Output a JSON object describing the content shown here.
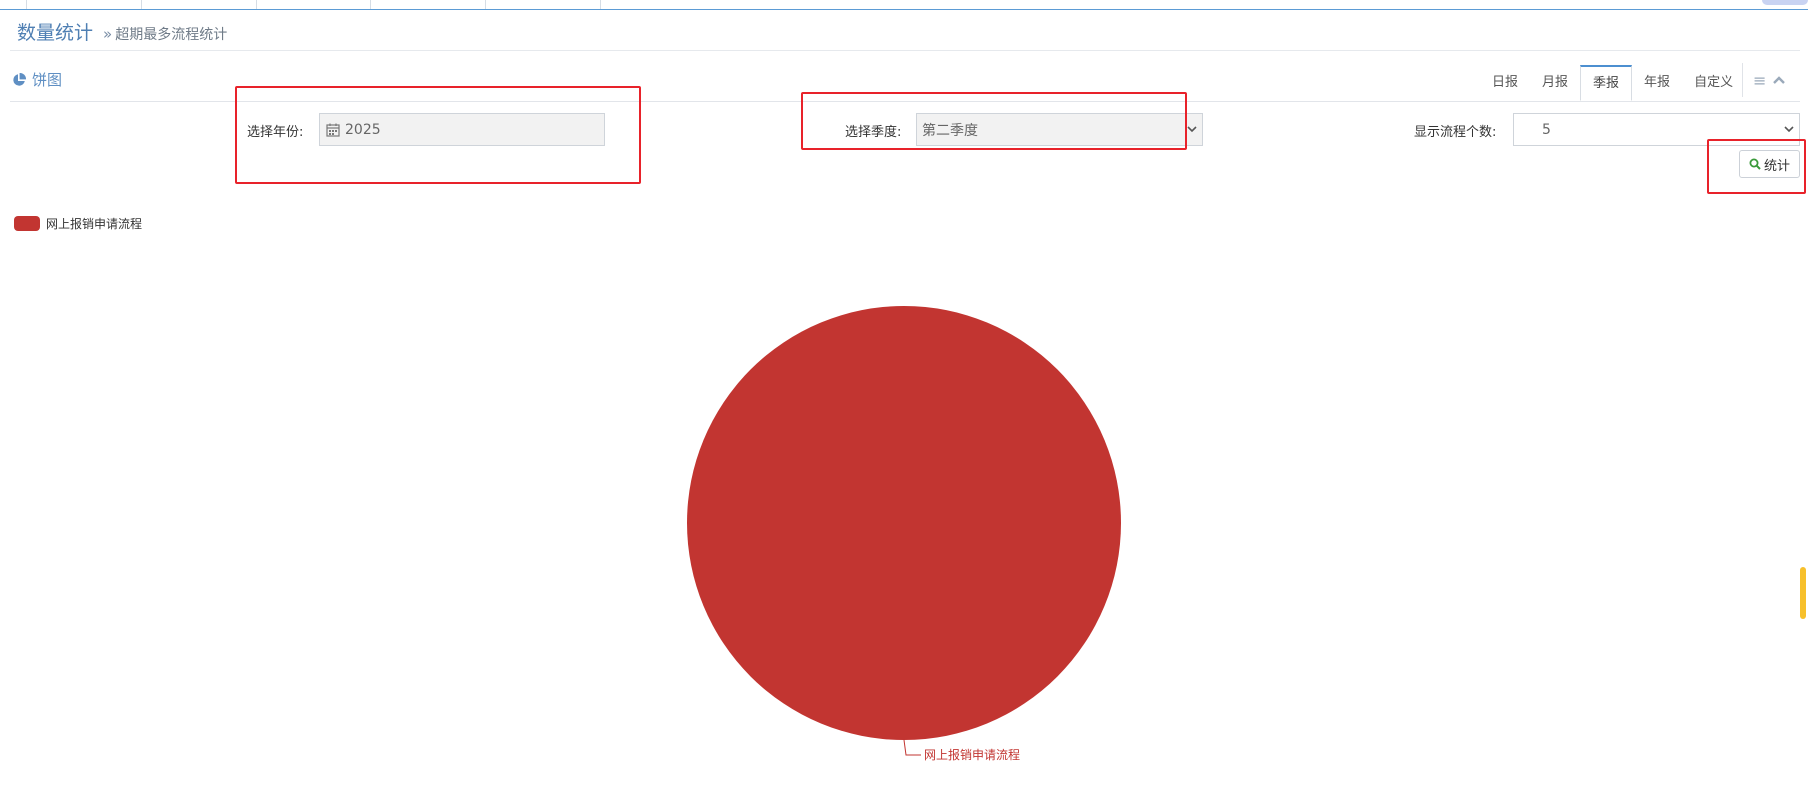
{
  "breadcrumb": {
    "title": "数量统计",
    "separator": "»",
    "current": "超期最多流程统计"
  },
  "panel": {
    "icon": "pie-chart-icon",
    "title": "饼图",
    "tabs": [
      {
        "label": "日报",
        "active": false
      },
      {
        "label": "月报",
        "active": false
      },
      {
        "label": "季报",
        "active": true
      },
      {
        "label": "年报",
        "active": false
      },
      {
        "label": "自定义",
        "active": false
      }
    ],
    "tools": {
      "menu_icon": "≡",
      "collapse_icon": "^"
    }
  },
  "form": {
    "year_label": "选择年份:",
    "year_value": "2025",
    "quarter_label": "选择季度:",
    "quarter_value": "第二季度",
    "count_label": "显示流程个数:",
    "count_value": "5",
    "submit_label": "统计"
  },
  "colors": {
    "series": "#c23531",
    "accent": "#4c8fd0",
    "annotation": "#e8222a"
  },
  "chart_data": {
    "type": "pie",
    "legend": [
      "网上报销申请流程"
    ],
    "legend_position": "top-left",
    "slices": [
      {
        "name": "网上报销申请流程",
        "value": 1,
        "color": "#c23531"
      }
    ]
  }
}
